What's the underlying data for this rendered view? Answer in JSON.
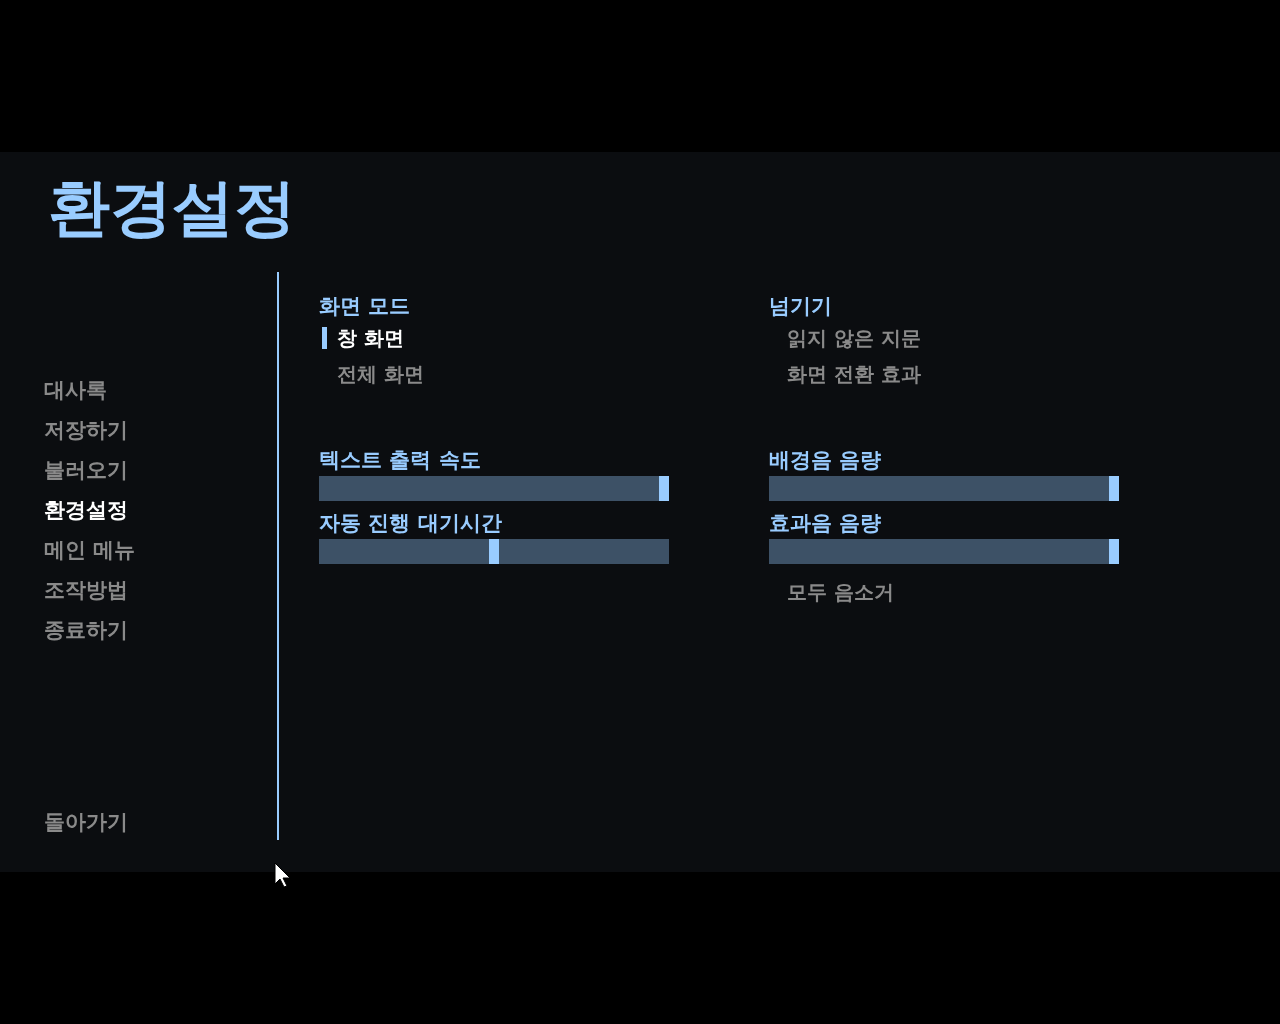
{
  "title": "환경설정",
  "nav": [
    {
      "label": "대사록",
      "selected": false
    },
    {
      "label": "저장하기",
      "selected": false
    },
    {
      "label": "불러오기",
      "selected": false
    },
    {
      "label": "환경설정",
      "selected": true
    },
    {
      "label": "메인 메뉴",
      "selected": false
    },
    {
      "label": "조작방법",
      "selected": false
    },
    {
      "label": "종료하기",
      "selected": false
    }
  ],
  "back": "돌아가기",
  "display": {
    "heading": "화면 모드",
    "options": [
      {
        "label": "창 화면",
        "selected": true
      },
      {
        "label": "전체 화면",
        "selected": false
      }
    ]
  },
  "skip": {
    "heading": "넘기기",
    "options": [
      {
        "label": "읽지 않은 지문",
        "checked": false
      },
      {
        "label": "화면 전환 효과",
        "checked": false
      }
    ]
  },
  "left_sliders": [
    {
      "label": "텍스트 출력 속도",
      "level": 1
    },
    {
      "label": "자동 진행 대기시간",
      "level": 0.5
    }
  ],
  "right_sliders": [
    {
      "label": "배경음 음량",
      "level": 1
    },
    {
      "label": "효과음 음량",
      "level": 1
    }
  ],
  "mute_all": {
    "label": "모두 음소거",
    "checked": false
  }
}
